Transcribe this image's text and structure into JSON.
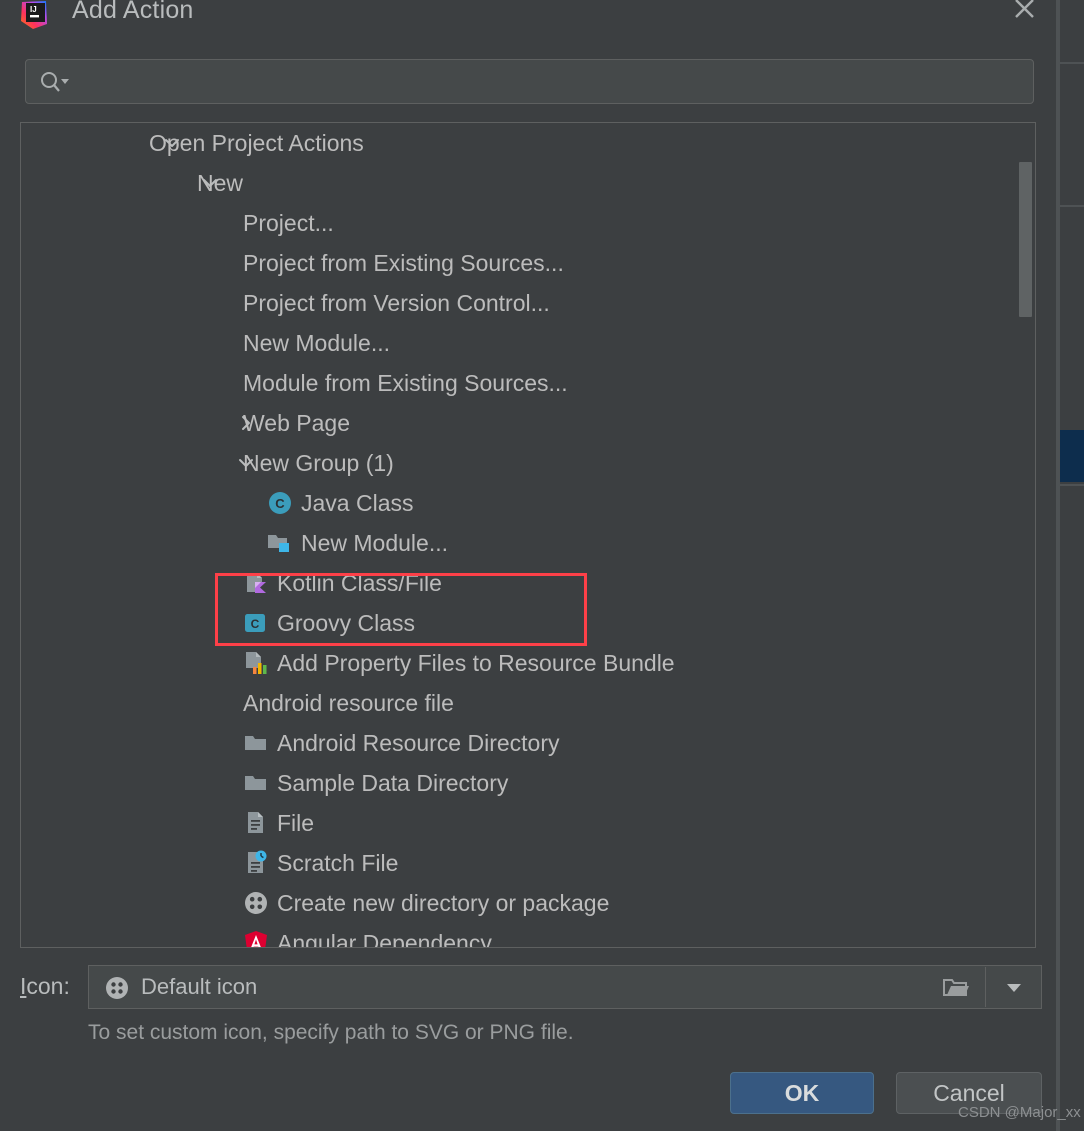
{
  "window": {
    "title": "Add Action",
    "app_icon": "intellij-idea-logo",
    "close_icon": "close-icon"
  },
  "search": {
    "value": "",
    "placeholder": "",
    "icon": "search-icon"
  },
  "tree": {
    "rows": [
      {
        "label": "Open Project Actions",
        "twisty": "expanded",
        "indent": 0,
        "icon": null
      },
      {
        "label": "New",
        "twisty": "expanded",
        "indent": 1,
        "icon": null
      },
      {
        "label": "Project...",
        "twisty": null,
        "indent": 2,
        "icon": null
      },
      {
        "label": "Project from Existing Sources...",
        "twisty": null,
        "indent": 2,
        "icon": null
      },
      {
        "label": "Project from Version Control...",
        "twisty": null,
        "indent": 2,
        "icon": null
      },
      {
        "label": "New Module...",
        "twisty": null,
        "indent": 2,
        "icon": null
      },
      {
        "label": "Module from Existing Sources...",
        "twisty": null,
        "indent": 2,
        "icon": null
      },
      {
        "label": "Web Page",
        "twisty": "collapsed",
        "indent": 2,
        "icon": null
      },
      {
        "label": "New Group (1)",
        "twisty": "expanded",
        "indent": 2,
        "icon": null
      },
      {
        "label": "Java Class",
        "twisty": null,
        "indent": 3,
        "icon": "java-class-icon"
      },
      {
        "label": "New Module...",
        "twisty": null,
        "indent": 3,
        "icon": "module-folder-icon"
      },
      {
        "label": "Kotlin Class/File",
        "twisty": null,
        "indent": 2,
        "icon": "kotlin-file-icon"
      },
      {
        "label": "Groovy Class",
        "twisty": null,
        "indent": 2,
        "icon": "groovy-class-icon"
      },
      {
        "label": "Add Property Files to Resource Bundle",
        "twisty": null,
        "indent": 2,
        "icon": "resource-bundle-icon"
      },
      {
        "label": "Android resource file",
        "twisty": null,
        "indent": 2,
        "icon": null
      },
      {
        "label": "Android Resource Directory",
        "twisty": null,
        "indent": 2,
        "icon": "folder-icon"
      },
      {
        "label": "Sample Data Directory",
        "twisty": null,
        "indent": 2,
        "icon": "folder-icon"
      },
      {
        "label": "File",
        "twisty": null,
        "indent": 2,
        "icon": "file-icon"
      },
      {
        "label": "Scratch File",
        "twisty": null,
        "indent": 2,
        "icon": "scratch-file-icon"
      },
      {
        "label": "Create new directory or package",
        "twisty": null,
        "indent": 2,
        "icon": "default-dots-icon"
      },
      {
        "label": "Angular Dependency",
        "twisty": null,
        "indent": 2,
        "icon": "angular-icon"
      }
    ],
    "highlight_color": "#fe4048"
  },
  "icon_field": {
    "label_prefix": "I",
    "label_rest": "con:",
    "value": "Default icon",
    "value_icon": "default-dots-icon",
    "browse_icon": "folder-open-icon",
    "dropdown_icon": "chevron-down-icon",
    "hint": "To set custom icon, specify path to SVG or PNG file."
  },
  "buttons": {
    "ok": "OK",
    "cancel": "Cancel",
    "ok_color": "#365880"
  },
  "watermark": "CSDN @Major_xx"
}
